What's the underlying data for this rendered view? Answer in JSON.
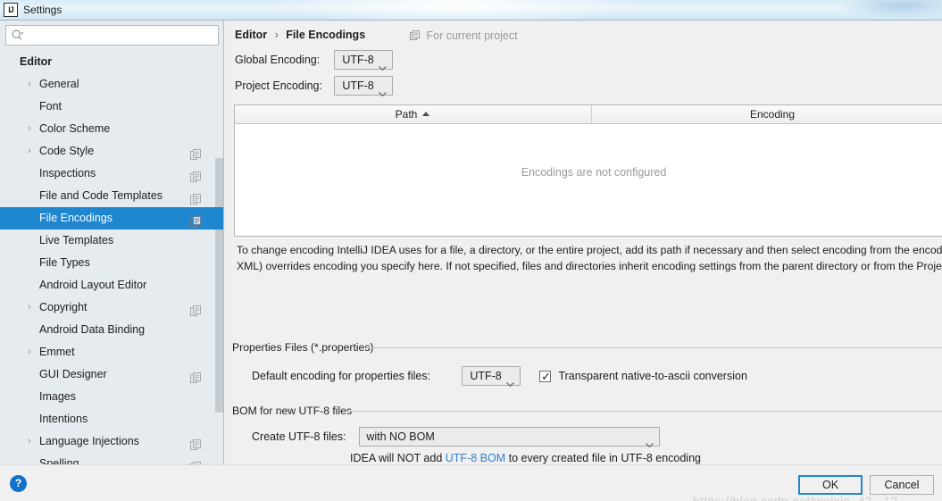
{
  "window": {
    "title": "Settings",
    "icon": "intellij-idea-icon"
  },
  "sidebar": {
    "search": {
      "value": "",
      "placeholder": ""
    },
    "items": [
      {
        "label": "Editor",
        "type": "group",
        "expandable": false,
        "copy_icon": false,
        "selected": false
      },
      {
        "label": "General",
        "type": "item",
        "expandable": true,
        "copy_icon": false,
        "selected": false
      },
      {
        "label": "Font",
        "type": "item",
        "expandable": false,
        "copy_icon": false,
        "selected": false
      },
      {
        "label": "Color Scheme",
        "type": "item",
        "expandable": true,
        "copy_icon": false,
        "selected": false
      },
      {
        "label": "Code Style",
        "type": "item",
        "expandable": true,
        "copy_icon": true,
        "selected": false
      },
      {
        "label": "Inspections",
        "type": "item",
        "expandable": false,
        "copy_icon": true,
        "selected": false
      },
      {
        "label": "File and Code Templates",
        "type": "item",
        "expandable": false,
        "copy_icon": true,
        "selected": false
      },
      {
        "label": "File Encodings",
        "type": "item",
        "expandable": false,
        "copy_icon": true,
        "selected": true
      },
      {
        "label": "Live Templates",
        "type": "item",
        "expandable": false,
        "copy_icon": false,
        "selected": false
      },
      {
        "label": "File Types",
        "type": "item",
        "expandable": false,
        "copy_icon": false,
        "selected": false
      },
      {
        "label": "Android Layout Editor",
        "type": "item",
        "expandable": false,
        "copy_icon": false,
        "selected": false
      },
      {
        "label": "Copyright",
        "type": "item",
        "expandable": true,
        "copy_icon": true,
        "selected": false
      },
      {
        "label": "Android Data Binding",
        "type": "item",
        "expandable": false,
        "copy_icon": false,
        "selected": false
      },
      {
        "label": "Emmet",
        "type": "item",
        "expandable": true,
        "copy_icon": false,
        "selected": false
      },
      {
        "label": "GUI Designer",
        "type": "item",
        "expandable": false,
        "copy_icon": true,
        "selected": false
      },
      {
        "label": "Images",
        "type": "item",
        "expandable": false,
        "copy_icon": false,
        "selected": false
      },
      {
        "label": "Intentions",
        "type": "item",
        "expandable": false,
        "copy_icon": false,
        "selected": false
      },
      {
        "label": "Language Injections",
        "type": "item",
        "expandable": true,
        "copy_icon": true,
        "selected": false
      },
      {
        "label": "Spelling",
        "type": "item",
        "expandable": false,
        "copy_icon": true,
        "selected": false
      }
    ]
  },
  "content": {
    "breadcrumb": {
      "root": "Editor",
      "separator": "›",
      "current": "File Encodings"
    },
    "for_current_project": "For current project",
    "global_encoding": {
      "label": "Global Encoding:",
      "value": "UTF-8"
    },
    "project_encoding": {
      "label": "Project Encoding:",
      "value": "UTF-8"
    },
    "table": {
      "columns": [
        "Path",
        "Encoding"
      ],
      "sorted_column": "Path",
      "sort_direction": "ascending",
      "rows": [],
      "empty_text": "Encodings are not configured"
    },
    "description": "To change encoding IntelliJ IDEA uses for a file, a directory, or the entire project, add its path if necessary and then select encoding from the encoding list. Built-in file encoding (e.g. JSP, HTML or XML) overrides encoding you specify here. If not specified, files and directories inherit encoding settings from the parent directory or from the Project Encoding.",
    "properties_group": {
      "title": "Properties Files (*.properties)",
      "default_encoding_label": "Default encoding for properties files:",
      "default_encoding_value": "UTF-8",
      "transparent_conversion_label": "Transparent native-to-ascii conversion",
      "transparent_conversion_checked": true,
      "checkmark": "✓"
    },
    "bom_group": {
      "title": "BOM for new UTF-8 files",
      "create_label": "Create UTF-8 files:",
      "create_value": "with NO BOM",
      "hint_before": "IDEA will NOT add ",
      "hint_link": "UTF-8 BOM",
      "hint_after": " to every created file in UTF-8 encoding"
    }
  },
  "footer": {
    "help_label": "?",
    "ok_label": "OK",
    "cancel_label": "Cancel"
  },
  "watermark": "https://blog.csdn.net/weixin_43...12",
  "colors": {
    "selection_blue": "#1f86d0",
    "link_blue": "#2f7fd1",
    "sidebar_bg": "#e6ebef",
    "dialog_bg": "#f0f0f0",
    "muted_text": "#9a9a9a"
  }
}
